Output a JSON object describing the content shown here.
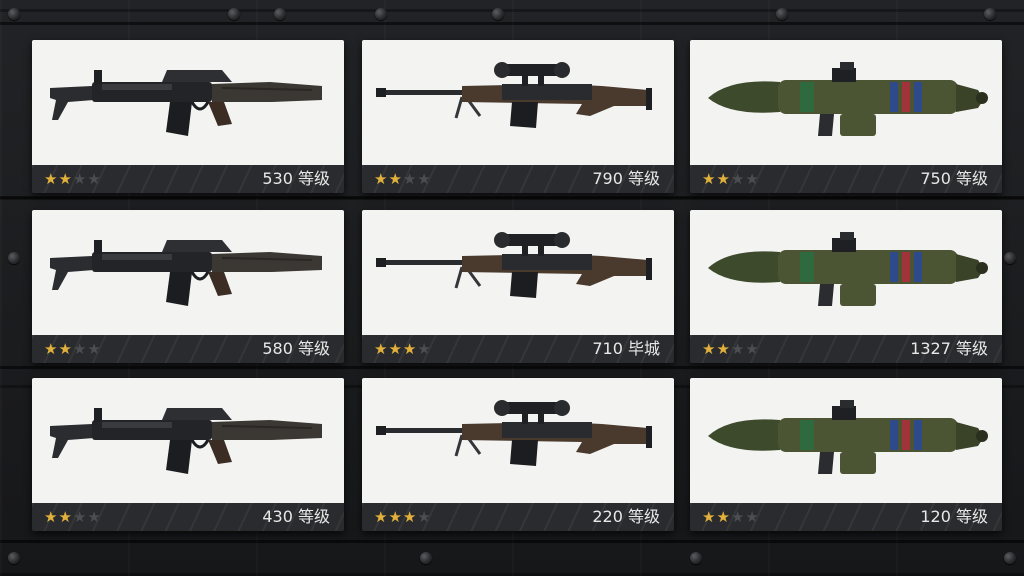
{
  "colors": {
    "star_filled": "#e2b13c",
    "star_empty": "#4c4d50",
    "card_bg": "#f3f3f2",
    "bar_bg": "#2a2b2e"
  },
  "icons": {
    "star_filled": "★",
    "star_empty": "★"
  },
  "cards": [
    {
      "weapon": "assault-rifle",
      "stars": 2,
      "max_stars": 4,
      "level": "530 等级"
    },
    {
      "weapon": "sniper-rifle",
      "stars": 2,
      "max_stars": 4,
      "level": "790 等级"
    },
    {
      "weapon": "rocket-launcher",
      "stars": 2,
      "max_stars": 4,
      "level": "750 等级"
    },
    {
      "weapon": "assault-rifle",
      "stars": 2,
      "max_stars": 4,
      "level": "580 等级"
    },
    {
      "weapon": "sniper-rifle",
      "stars": 3,
      "max_stars": 4,
      "level": "710 毕城"
    },
    {
      "weapon": "rocket-launcher",
      "stars": 2,
      "max_stars": 4,
      "level": "1327 等级"
    },
    {
      "weapon": "assault-rifle",
      "stars": 2,
      "max_stars": 4,
      "level": "430 等级"
    },
    {
      "weapon": "sniper-rifle",
      "stars": 3,
      "max_stars": 4,
      "level": "220 等级"
    },
    {
      "weapon": "rocket-launcher",
      "stars": 2,
      "max_stars": 4,
      "level": "120 等级"
    }
  ]
}
